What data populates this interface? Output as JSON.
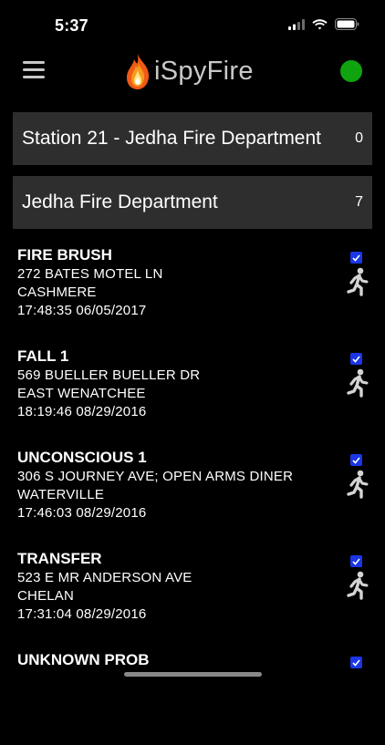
{
  "status_bar": {
    "time": "5:37"
  },
  "header": {
    "app_name": "iSpyFire",
    "connection_color": "#0fa40f"
  },
  "departments": [
    {
      "name": "Station 21 - Jedha Fire Department",
      "count": "0"
    },
    {
      "name": "Jedha Fire Department",
      "count": "7"
    }
  ],
  "incidents": [
    {
      "title": "FIRE BRUSH",
      "address": "272 BATES MOTEL LN",
      "city": "CASHMERE",
      "datetime": "17:48:35 06/05/2017"
    },
    {
      "title": "FALL 1",
      "address": "569 BUELLER BUELLER DR",
      "city": "EAST WENATCHEE",
      "datetime": "18:19:46 08/29/2016"
    },
    {
      "title": "UNCONSCIOUS 1",
      "address": "306 S JOURNEY AVE; OPEN ARMS DINER",
      "city": "WATERVILLE",
      "datetime": "17:46:03 08/29/2016"
    },
    {
      "title": "TRANSFER",
      "address": "523 E MR ANDERSON AVE",
      "city": "CHELAN",
      "datetime": "17:31:04 08/29/2016"
    },
    {
      "title": "UNKNOWN PROB",
      "address": "",
      "city": "",
      "datetime": ""
    }
  ],
  "icons": {
    "menu": "hamburger-menu-icon",
    "logo": "flame-icon",
    "responding": "runner-icon",
    "checked": "checkbox-checked-icon"
  }
}
